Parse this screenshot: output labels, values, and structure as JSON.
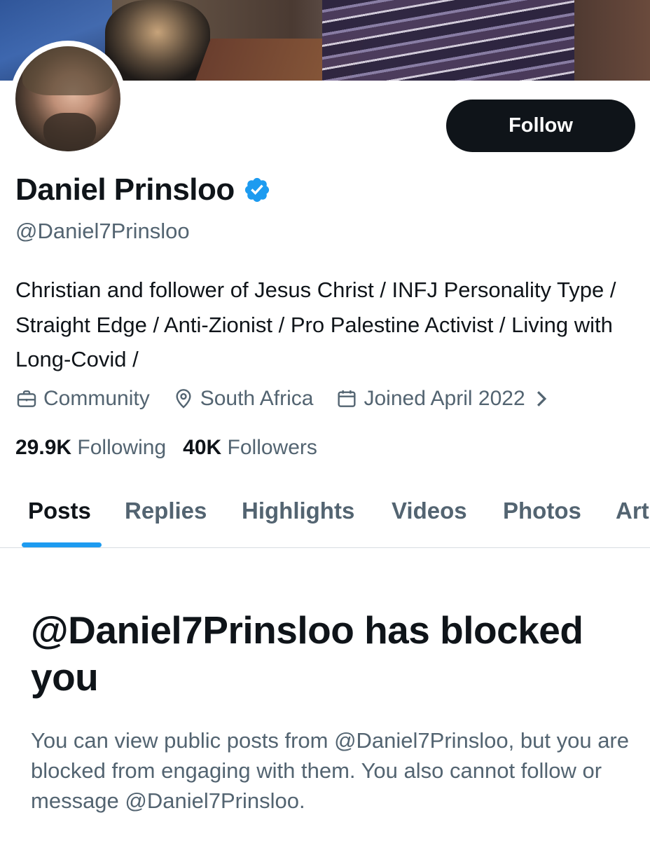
{
  "profile": {
    "display_name": "Daniel Prinsloo",
    "handle": "@Daniel7Prinsloo",
    "verified": true,
    "bio": "Christian and follower of Jesus Christ / INFJ Personality Type / Straight Edge / Anti-Zionist / Pro Palestine Activist / Living with Long-Covid /",
    "category": "Community",
    "location": "South Africa",
    "joined": "Joined April 2022",
    "following_count": "29.9K",
    "following_label": "Following",
    "followers_count": "40K",
    "followers_label": "Followers"
  },
  "actions": {
    "follow_label": "Follow"
  },
  "tabs": [
    {
      "label": "Posts",
      "active": true
    },
    {
      "label": "Replies",
      "active": false
    },
    {
      "label": "Highlights",
      "active": false
    },
    {
      "label": "Videos",
      "active": false
    },
    {
      "label": "Photos",
      "active": false
    },
    {
      "label": "Art",
      "active": false
    }
  ],
  "blocked": {
    "title": "@Daniel7Prinsloo has blocked you",
    "description": "You can view public posts from @Daniel7Prinsloo, but you are blocked from engaging with them. You also cannot follow or message @Daniel7Prinsloo."
  },
  "icons": {
    "verified": "verified-badge-icon",
    "category": "briefcase-icon",
    "location": "location-pin-icon",
    "joined": "calendar-icon",
    "more": "chevron-right-icon"
  },
  "colors": {
    "accent": "#1d9bf0",
    "text_primary": "#0f1419",
    "text_secondary": "#536471",
    "button_bg": "#0f1419"
  }
}
